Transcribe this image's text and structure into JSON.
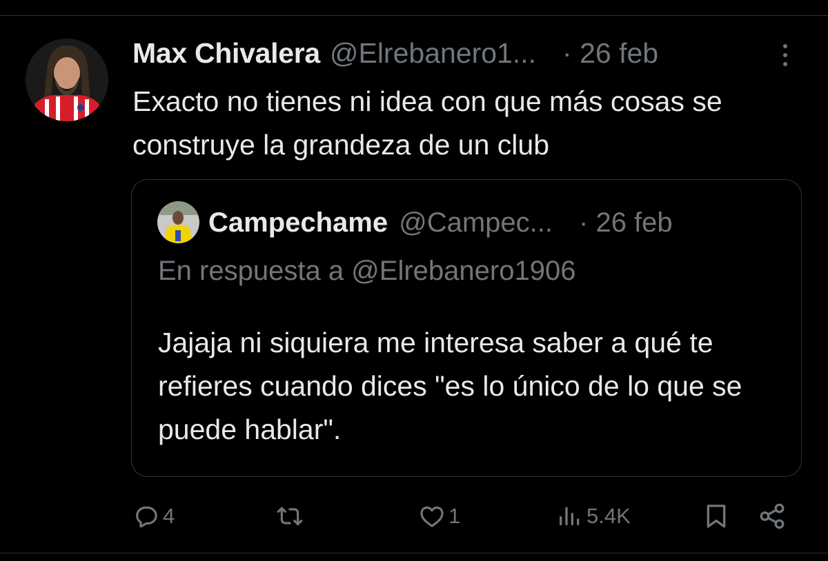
{
  "tweet": {
    "display_name": "Max Chivalera",
    "handle": "@Elrebanero1...",
    "date": "· 26 feb",
    "text": "Exacto no tienes ni idea con que más cosas se construye la grandeza de un club",
    "avatar_icon": "bearded-man-avatar"
  },
  "quote": {
    "display_name": "Campechame",
    "handle": "@Campec...",
    "date": "· 26 feb",
    "reply_to": "En respuesta a @Elrebanero1906",
    "text": "Jajaja ni siquiera me interesa saber a qué te refieres cuando dices \"es lo único de lo que se puede hablar\".",
    "avatar_icon": "soccer-player-avatar"
  },
  "actions": {
    "replies": "4",
    "retweets": "",
    "likes": "1",
    "views": "5.4K"
  },
  "colors": {
    "background": "#000000",
    "text_primary": "#e7e9ea",
    "text_secondary": "#71767b",
    "border": "#2f3336"
  }
}
